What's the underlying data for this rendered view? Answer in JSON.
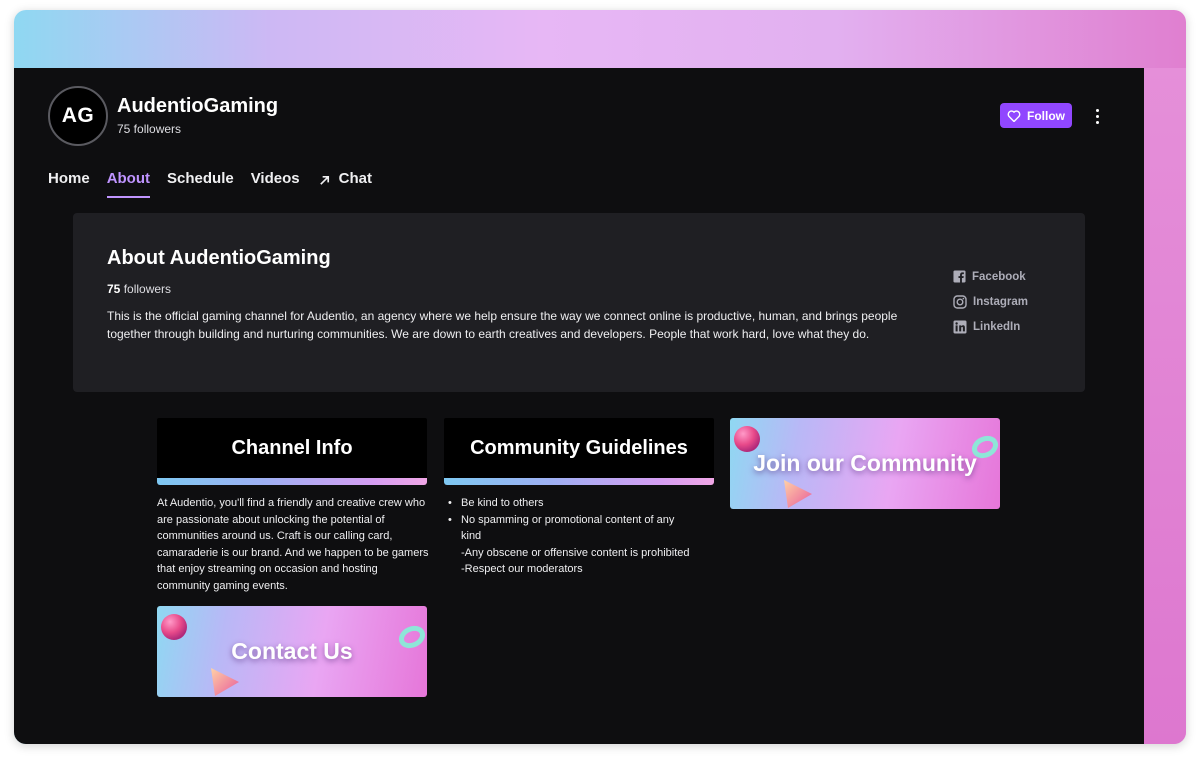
{
  "channel": {
    "initials": "AG",
    "name": "AudentioGaming",
    "followers": "75 followers",
    "follow_label": "Follow"
  },
  "tabs": [
    {
      "label": "Home",
      "active": false
    },
    {
      "label": "About",
      "active": true
    },
    {
      "label": "Schedule",
      "active": false
    },
    {
      "label": "Videos",
      "active": false
    },
    {
      "label": "Chat",
      "active": false,
      "icon": "external-arrow-icon"
    }
  ],
  "about": {
    "title": "About AudentioGaming",
    "followers_count": "75",
    "followers_suffix": "followers",
    "description": "This is the official gaming channel for Audentio, an agency where we help ensure the way we connect online is productive, human, and brings people together through building and nurturing communities. We are down to earth creatives and developers. People that work hard, love what they do.",
    "socials": [
      {
        "label": "Facebook",
        "icon": "facebook-icon"
      },
      {
        "label": "Instagram",
        "icon": "instagram-icon"
      },
      {
        "label": "LinkedIn",
        "icon": "linkedin-icon"
      }
    ]
  },
  "panels": {
    "channel_info": {
      "title": "Channel Info",
      "body": "At Audentio, you'll find a friendly and creative crew who are passionate about unlocking the potential of communities around us. Craft is our calling card, camaraderie is our brand. And we happen to be gamers that enjoy streaming on occasion and hosting community gaming events."
    },
    "guidelines": {
      "title": "Community Guidelines",
      "items": [
        "Be kind to others",
        "No spamming or promotional content of any kind",
        "-Any obscene or offensive content is prohibited",
        "-Respect our moderators"
      ]
    },
    "join": {
      "label": "Join our Community"
    },
    "contact": {
      "label": "Contact Us"
    }
  },
  "colors": {
    "accent": "#9147ff",
    "accent_light": "#bf94ff",
    "background": "#0e0e10",
    "panel": "#1f1f23"
  }
}
